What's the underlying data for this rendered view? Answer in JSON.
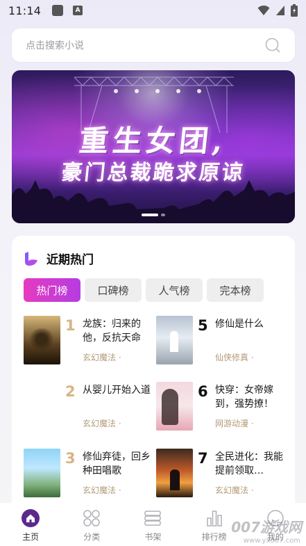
{
  "status_bar": {
    "time": "11:14"
  },
  "search": {
    "placeholder": "点击搜索小说"
  },
  "banner": {
    "line1": "重生女团,",
    "line2": "豪门总裁跪求原谅",
    "slide_count": 2,
    "active_slide": 1
  },
  "hot": {
    "title": "近期热门",
    "tabs": [
      {
        "label": "热门榜",
        "active": true
      },
      {
        "label": "口碑榜",
        "active": false
      },
      {
        "label": "人气榜",
        "active": false
      },
      {
        "label": "完本榜",
        "active": false
      }
    ],
    "books": [
      {
        "rank": "1",
        "name": "龙族：归来的他，反抗天命",
        "genre": "玄幻魔法 ·"
      },
      {
        "rank": "2",
        "name": "从婴儿开始入道",
        "genre": "玄幻魔法 ·"
      },
      {
        "rank": "3",
        "name": "修仙弃徒，回乡种田唱歌",
        "genre": "玄幻魔法 ·"
      },
      {
        "rank": "5",
        "name": "修仙是什么",
        "genre": "仙侠修真 ·"
      },
      {
        "rank": "6",
        "name": "快穿：女帝嫁到，强势撩！",
        "genre": "网游动漫 ·"
      },
      {
        "rank": "7",
        "name": "全民进化：我能提前领取…",
        "genre": "玄幻魔法 ·"
      }
    ]
  },
  "nav": {
    "items": [
      {
        "label": "主页",
        "active": true
      },
      {
        "label": "分类",
        "active": false
      },
      {
        "label": "书架",
        "active": false
      },
      {
        "label": "排行榜",
        "active": false
      },
      {
        "label": "我的",
        "active": false
      }
    ]
  },
  "watermark": {
    "text": "007游戏网",
    "url": "www.yx007.com"
  },
  "colors": {
    "accent_start": "#e53bbf",
    "accent_end": "#b53ce2",
    "rank_gold": "#d6b484",
    "genre": "#b49a78"
  }
}
